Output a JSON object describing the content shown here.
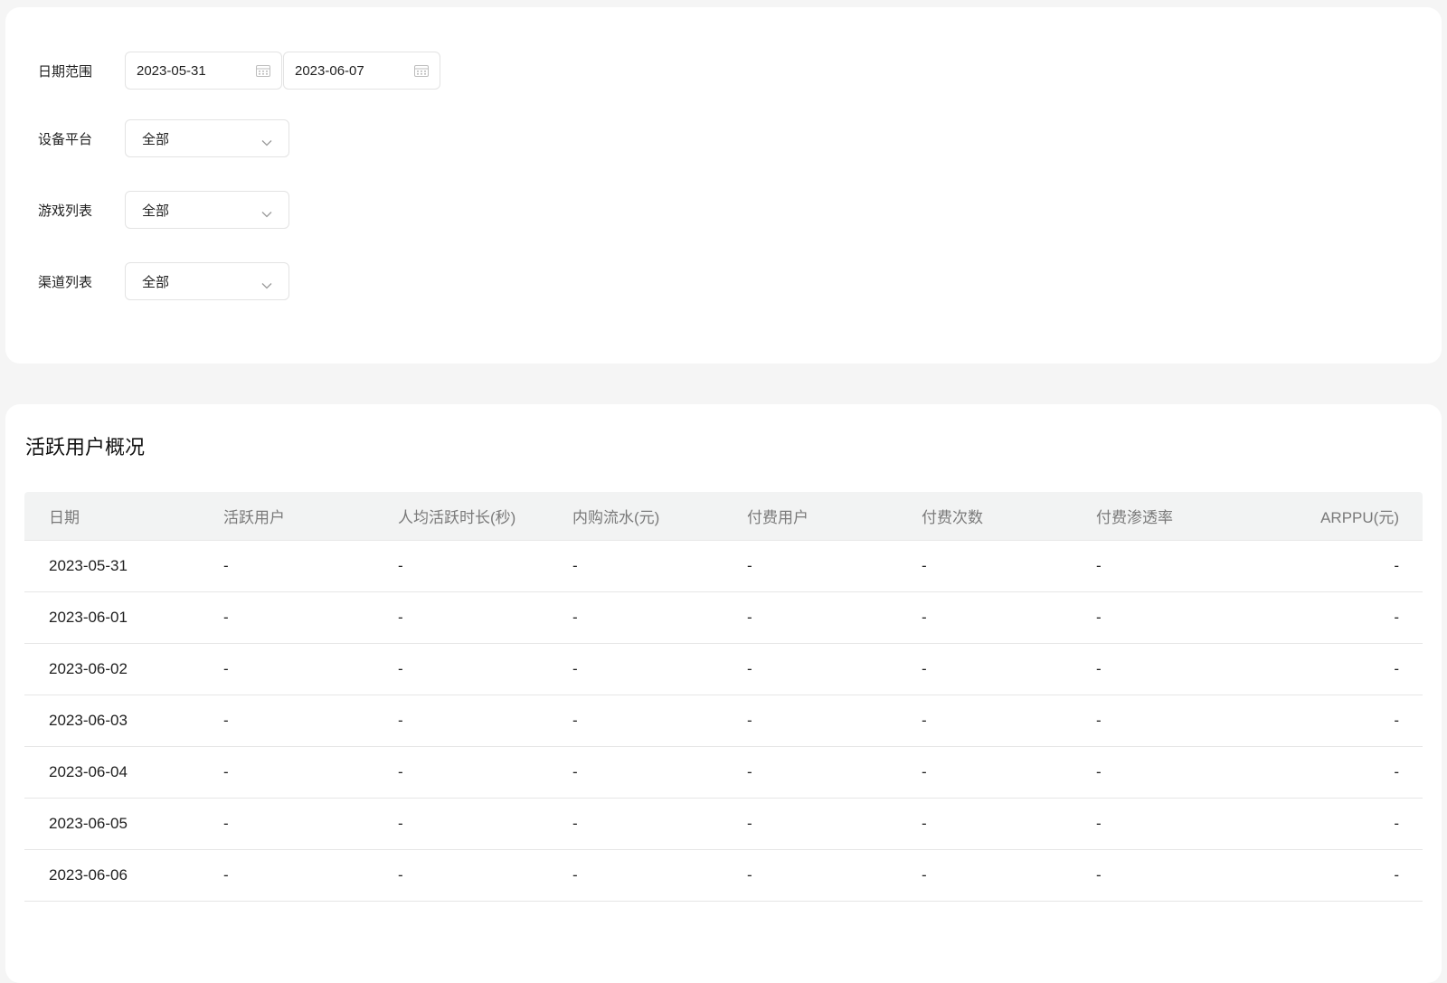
{
  "filters": {
    "date_range": {
      "label": "日期范围",
      "start": "2023-05-31",
      "end": "2023-06-07"
    },
    "platform": {
      "label": "设备平台",
      "value": "全部"
    },
    "games": {
      "label": "游戏列表",
      "value": "全部"
    },
    "channels": {
      "label": "渠道列表",
      "value": "全部"
    }
  },
  "overview": {
    "title": "活跃用户概况",
    "columns": [
      "日期",
      "活跃用户",
      "人均活跃时长(秒)",
      "内购流水(元)",
      "付费用户",
      "付费次数",
      "付费渗透率",
      "ARPPU(元)"
    ],
    "rows": [
      [
        "2023-05-31",
        "-",
        "-",
        "-",
        "-",
        "-",
        "-",
        "-"
      ],
      [
        "2023-06-01",
        "-",
        "-",
        "-",
        "-",
        "-",
        "-",
        "-"
      ],
      [
        "2023-06-02",
        "-",
        "-",
        "-",
        "-",
        "-",
        "-",
        "-"
      ],
      [
        "2023-06-03",
        "-",
        "-",
        "-",
        "-",
        "-",
        "-",
        "-"
      ],
      [
        "2023-06-04",
        "-",
        "-",
        "-",
        "-",
        "-",
        "-",
        "-"
      ],
      [
        "2023-06-05",
        "-",
        "-",
        "-",
        "-",
        "-",
        "-",
        "-"
      ],
      [
        "2023-06-06",
        "-",
        "-",
        "-",
        "-",
        "-",
        "-",
        "-"
      ]
    ]
  },
  "icons": {
    "date": "calendar-icon",
    "select": "chevron-down-icon"
  }
}
